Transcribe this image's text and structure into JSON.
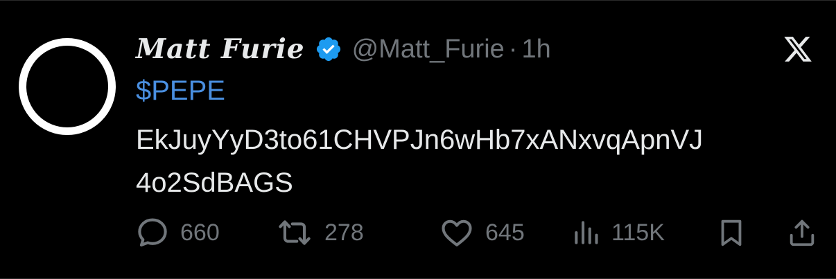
{
  "tweet": {
    "display_name": "Matt Furie",
    "handle": "@Matt_Furie",
    "separator": "·",
    "time": "1h",
    "cashtag": "$PEPE",
    "body_lines": [
      "EkJuyYyD3to61CHVPJn6wHb7xANxvqApnVJ",
      "4o2SdBAGS"
    ],
    "verified": true
  },
  "actions": {
    "replies": "660",
    "reposts": "278",
    "likes": "645",
    "views": "115K"
  },
  "icons": {
    "verified": "verified-badge-icon",
    "platform": "x-logo-icon",
    "reply": "reply-icon",
    "repost": "repost-icon",
    "like": "heart-icon",
    "views": "views-icon",
    "bookmark": "bookmark-icon",
    "share": "share-icon"
  },
  "colors": {
    "background": "#000000",
    "text": "#e7e9ea",
    "muted": "#71767b",
    "link": "#4a8fe0",
    "verified": "#1d9bf0"
  }
}
